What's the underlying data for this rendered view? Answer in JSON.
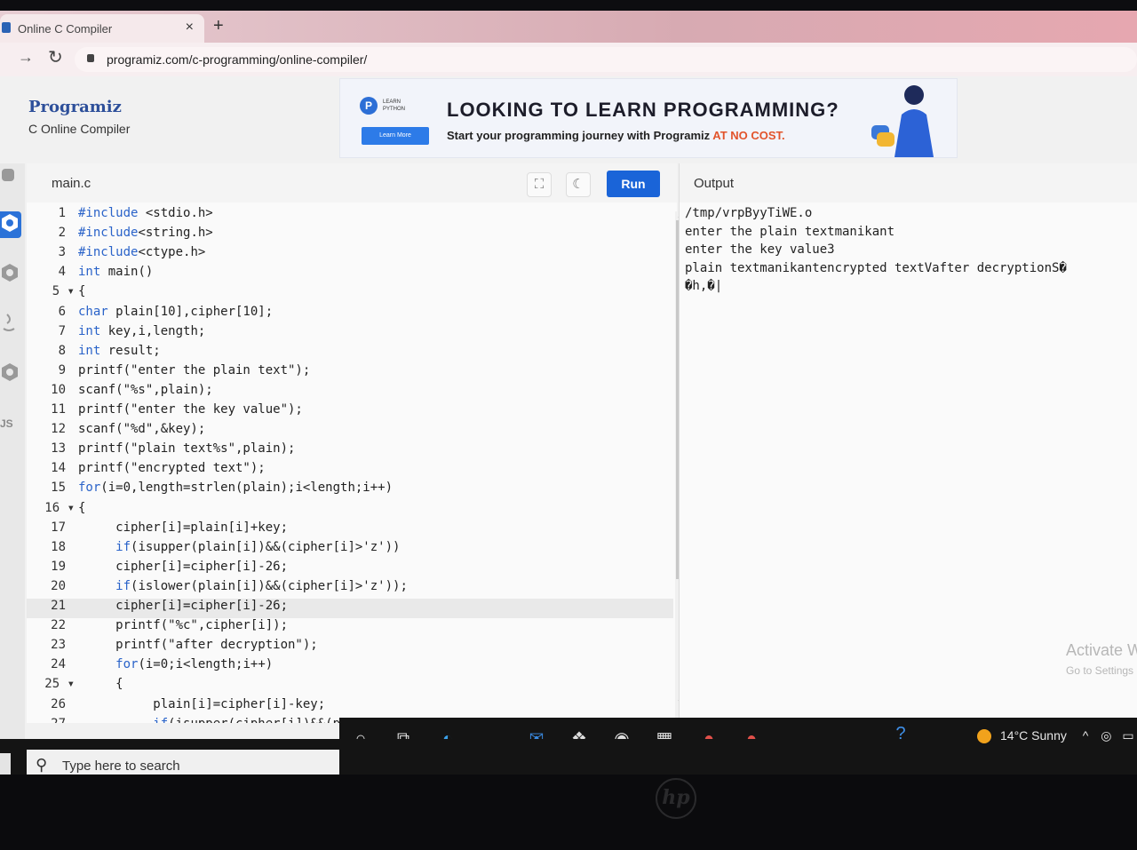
{
  "browser": {
    "tab_title": "Online C Compiler",
    "tab_close": "×",
    "new_tab": "+",
    "url": "programiz.com/c-programming/online-compiler/"
  },
  "brand": {
    "logo": "Programiz",
    "subtitle": "C Online Compiler"
  },
  "ad": {
    "logo_letter": "P",
    "small_text": "LEARN PYTHON",
    "button": "Learn More",
    "headline": "LOOKING TO LEARN PROGRAMMING?",
    "subline": "Start your programming journey with Programiz",
    "subline_accent": "AT NO COST."
  },
  "sidebar": {
    "items": [
      {
        "icon": "python-icon",
        "label": ""
      },
      {
        "icon": "c-icon",
        "label": "",
        "active": true
      },
      {
        "icon": "cpp-icon",
        "label": ""
      },
      {
        "icon": "java-icon",
        "label": ""
      },
      {
        "icon": "csharp-icon",
        "label": ""
      },
      {
        "icon": "js-icon",
        "label": "JS"
      }
    ]
  },
  "editor": {
    "filename": "main.c",
    "run_label": "Run",
    "lines": [
      {
        "n": "1",
        "code": "#include <stdio.h>"
      },
      {
        "n": "2",
        "code": "#include<string.h>"
      },
      {
        "n": "3",
        "code": "#include<ctype.h>"
      },
      {
        "n": "4",
        "code": "int main()"
      },
      {
        "n": "5 ▾",
        "code": "{"
      },
      {
        "n": "6",
        "code": "char plain[10],cipher[10];"
      },
      {
        "n": "7",
        "code": "int key,i,length;"
      },
      {
        "n": "8",
        "code": "int result;"
      },
      {
        "n": "9",
        "code": "printf(\"enter the plain text\");"
      },
      {
        "n": "10",
        "code": "scanf(\"%s\",plain);"
      },
      {
        "n": "11",
        "code": "printf(\"enter the key value\");"
      },
      {
        "n": "12",
        "code": "scanf(\"%d\",&key);"
      },
      {
        "n": "13",
        "code": "printf(\"plain text%s\",plain);"
      },
      {
        "n": "14",
        "code": "printf(\"encrypted text\");"
      },
      {
        "n": "15",
        "code": "for(i=0,length=strlen(plain);i<length;i++)"
      },
      {
        "n": "16 ▾",
        "code": "{"
      },
      {
        "n": "17",
        "code": "     cipher[i]=plain[i]+key;"
      },
      {
        "n": "18",
        "code": "     if(isupper(plain[i])&&(cipher[i]>'z'))"
      },
      {
        "n": "19",
        "code": "     cipher[i]=cipher[i]-26;"
      },
      {
        "n": "20",
        "code": "     if(islower(plain[i])&&(cipher[i]>'z'));"
      },
      {
        "n": "21",
        "code": "     cipher[i]=cipher[i]-26;"
      },
      {
        "n": "22",
        "code": "     printf(\"%c\",cipher[i]);"
      },
      {
        "n": "23",
        "code": "     printf(\"after decryption\");"
      },
      {
        "n": "24",
        "code": "     for(i=0;i<length;i++)"
      },
      {
        "n": "25 ▾",
        "code": "     {"
      },
      {
        "n": "26",
        "code": "          plain[i]=cipher[i]-key;"
      },
      {
        "n": "27",
        "code": "          if(isupper(cipher[i])&&(plain[i]<'A'))"
      }
    ],
    "highlighted_line": 21
  },
  "output": {
    "title": "Output",
    "lines": [
      "/tmp/vrpByyTiWE.o",
      "enter the plain textmanikant",
      "enter the key value3",
      "plain textmanikantencrypted textVafter decryptionS�",
      "�h,�|"
    ]
  },
  "watermark": {
    "line1": "Activate W",
    "line2": "Go to Settings"
  },
  "taskbar": {
    "search_placeholder": "Type here to search",
    "weather": "14°C Sunny"
  },
  "colors": {
    "run_button": "#1a64d8",
    "accent_orange": "#e2542b",
    "keyword": "#2a63c9",
    "string": "#333333"
  }
}
